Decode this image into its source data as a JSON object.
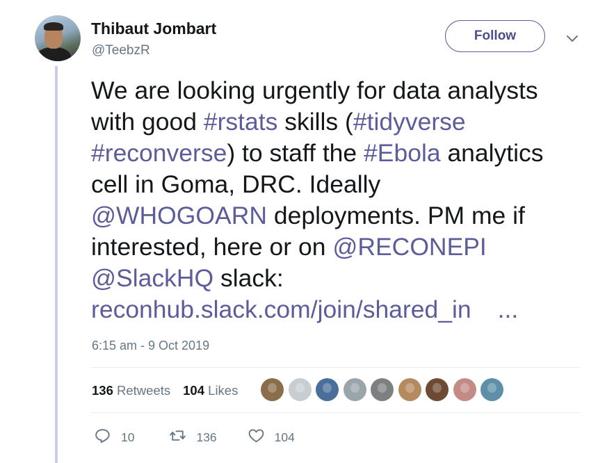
{
  "author": {
    "name": "Thibaut Jombart",
    "handle": "@TeebzR"
  },
  "follow_button": {
    "label": "Follow"
  },
  "tweet": {
    "lines": [
      [
        {
          "t": "We are looking urgently for data analysts",
          "link": false
        }
      ],
      [
        {
          "t": "with good ",
          "link": false
        },
        {
          "t": "#rstats",
          "link": true
        },
        {
          "t": " skills (",
          "link": false
        },
        {
          "t": "#tidyverse",
          "link": true
        }
      ],
      [
        {
          "t": "#reconverse",
          "link": true
        },
        {
          "t": ") to staff the ",
          "link": false
        },
        {
          "t": "#Ebola",
          "link": true
        },
        {
          "t": " analytics",
          "link": false
        }
      ],
      [
        {
          "t": "cell in Goma, DRC. Ideally",
          "link": false
        }
      ],
      [
        {
          "t": "@WHOGOARN",
          "link": true
        },
        {
          "t": " deployments. PM me if",
          "link": false
        }
      ],
      [
        {
          "t": "interested, here or on ",
          "link": false
        },
        {
          "t": "@RECONEPI",
          "link": true
        }
      ],
      [
        {
          "t": "@SlackHQ",
          "link": true
        },
        {
          "t": " slack:",
          "link": false
        }
      ]
    ],
    "url": "reconhub.slack.com/join/shared_in",
    "url_ellipsis": "..."
  },
  "timestamp": "6:15 am - 9 Oct 2019",
  "stats": {
    "retweets_count": "136",
    "retweets_label": "Retweets",
    "likes_count": "104",
    "likes_label": "Likes"
  },
  "likers": [
    {
      "name": "liker-1",
      "color": "#8a6d4b"
    },
    {
      "name": "liker-2",
      "color": "#c8cdd2"
    },
    {
      "name": "liker-3",
      "color": "#4a6f9a"
    },
    {
      "name": "liker-4",
      "color": "#9aa4ab"
    },
    {
      "name": "liker-5",
      "color": "#7d7f80"
    },
    {
      "name": "liker-6",
      "color": "#b48a5e"
    },
    {
      "name": "liker-7",
      "color": "#6e4a34"
    },
    {
      "name": "liker-8",
      "color": "#c48b86"
    },
    {
      "name": "liker-9",
      "color": "#5f8fa8"
    }
  ],
  "actions": {
    "reply_count": "10",
    "retweet_count": "136",
    "like_count": "104"
  },
  "colors": {
    "link": "#5b5d9a",
    "muted": "#657786",
    "thread_line": "#c9cbe8"
  }
}
